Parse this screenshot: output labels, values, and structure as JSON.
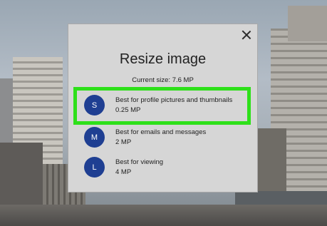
{
  "dialog": {
    "title": "Resize image",
    "current_size": "Current size: 7.6 MP",
    "options": [
      {
        "badge": "S",
        "label": "Best for profile pictures and thumbnails",
        "size": "0.25 MP",
        "highlighted": true
      },
      {
        "badge": "M",
        "label": "Best for emails and messages",
        "size": "2 MP",
        "highlighted": false
      },
      {
        "badge": "L",
        "label": "Best for viewing",
        "size": "4 MP",
        "highlighted": false
      }
    ]
  },
  "colors": {
    "badge": "#1f3f92",
    "highlight": "#2ee01a",
    "dialog_bg": "#d6d6d6"
  },
  "icons": {
    "close": "close-icon"
  }
}
